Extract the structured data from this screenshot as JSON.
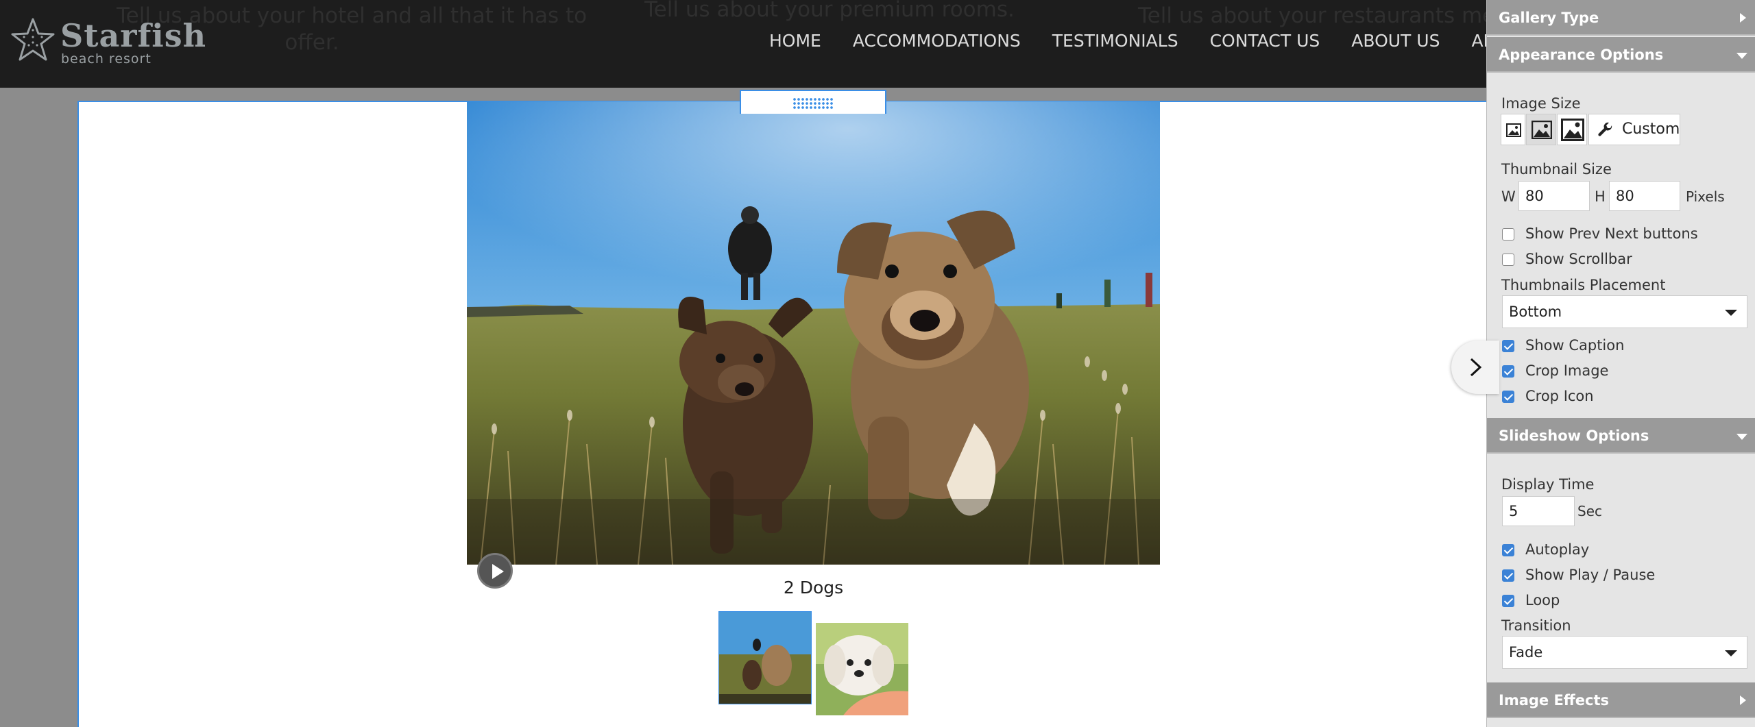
{
  "site": {
    "logo_title": "Starfish",
    "logo_subtitle": "beach resort",
    "ghost_texts": [
      "Tell us about your hotel and all that it has to",
      "offer.",
      "Tell us about your premium rooms.",
      "Tell us about your restaurants menu."
    ],
    "nav": [
      "HOME",
      "ACCOMMODATIONS",
      "TESTIMONIALS",
      "CONTACT US",
      "ABOUT US",
      "ABOUT US"
    ]
  },
  "gallery": {
    "caption": "2 Dogs",
    "main_image": "photo of two puppies running in a grass field",
    "thumbnails": [
      "two puppies in field",
      "white puppy held in hand"
    ],
    "icons": {
      "play": "play-icon",
      "next": "chevron-right-icon",
      "drag": "drag-handle-icon"
    }
  },
  "panel": {
    "gallery_type": "Gallery Type",
    "appearance_options": "Appearance Options",
    "image_size_label": "Image Size",
    "size_custom": "Custom",
    "thumbnail_size_label": "Thumbnail Size",
    "w_label": "W",
    "w_value": "80",
    "h_label": "H",
    "h_value": "80",
    "pixels": "Pixels",
    "show_prev_next": "Show Prev Next buttons",
    "show_scrollbar": "Show Scrollbar",
    "thumbnails_placement_label": "Thumbnails Placement",
    "thumbnails_placement": "Bottom",
    "show_caption": "Show Caption",
    "crop_image": "Crop Image",
    "crop_icon": "Crop Icon",
    "slideshow_options": "Slideshow Options",
    "display_time_label": "Display Time",
    "display_time_value": "5",
    "sec": "Sec",
    "autoplay": "Autoplay",
    "show_play_pause": "Show Play / Pause",
    "loop": "Loop",
    "transition_label": "Transition",
    "transition": "Fade",
    "image_effects": "Image Effects",
    "checked": {
      "show_prev_next": false,
      "show_scrollbar": false,
      "show_caption": true,
      "crop_image": true,
      "crop_icon": true,
      "autoplay": true,
      "show_play_pause": true,
      "loop": true
    }
  },
  "colors": {
    "accent": "#3a8ee6",
    "checkbox": "#3b82d6",
    "header_bg": "#1d1d1d",
    "panel_section": "#9a9a9a"
  }
}
